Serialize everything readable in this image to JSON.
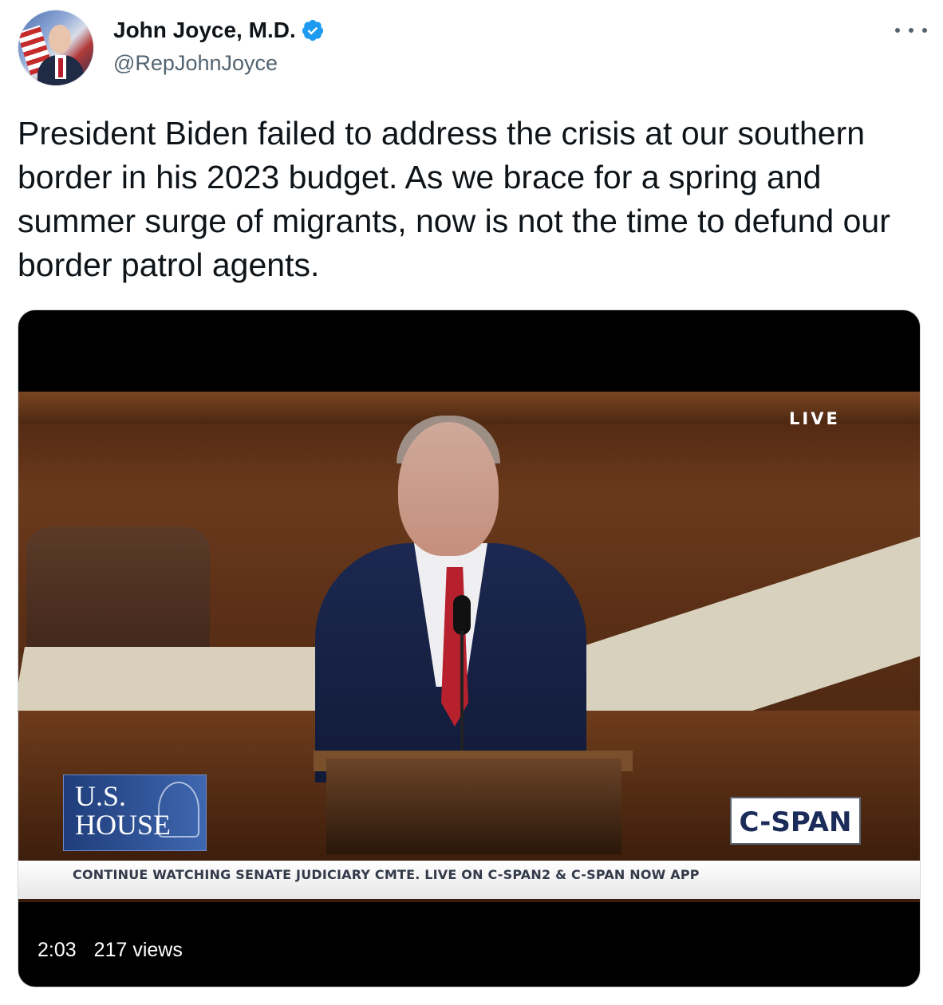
{
  "tweet": {
    "author": {
      "display_name": "John Joyce, M.D.",
      "handle": "@RepJohnJoyce",
      "verified": true
    },
    "text": "President Biden failed to address the crisis at our southern border in his 2023 budget. As we brace for a spring and summer surge of migrants, now is not the time to defund our border patrol agents.",
    "more_icon": "ellipsis-icon"
  },
  "video": {
    "live_label": "LIVE",
    "house_label": "U.S.\nHOUSE",
    "network_label": "C-SPAN",
    "ticker": "CONTINUE WATCHING SENATE JUDICIARY CMTE. LIVE ON C-SPAN2 & C-SPAN NOW APP",
    "duration": "2:03",
    "views": "217 views"
  },
  "colors": {
    "text_primary": "#0f1419",
    "text_secondary": "#536471",
    "verified_blue": "#1d9bf0",
    "border": "#cfd9de"
  }
}
